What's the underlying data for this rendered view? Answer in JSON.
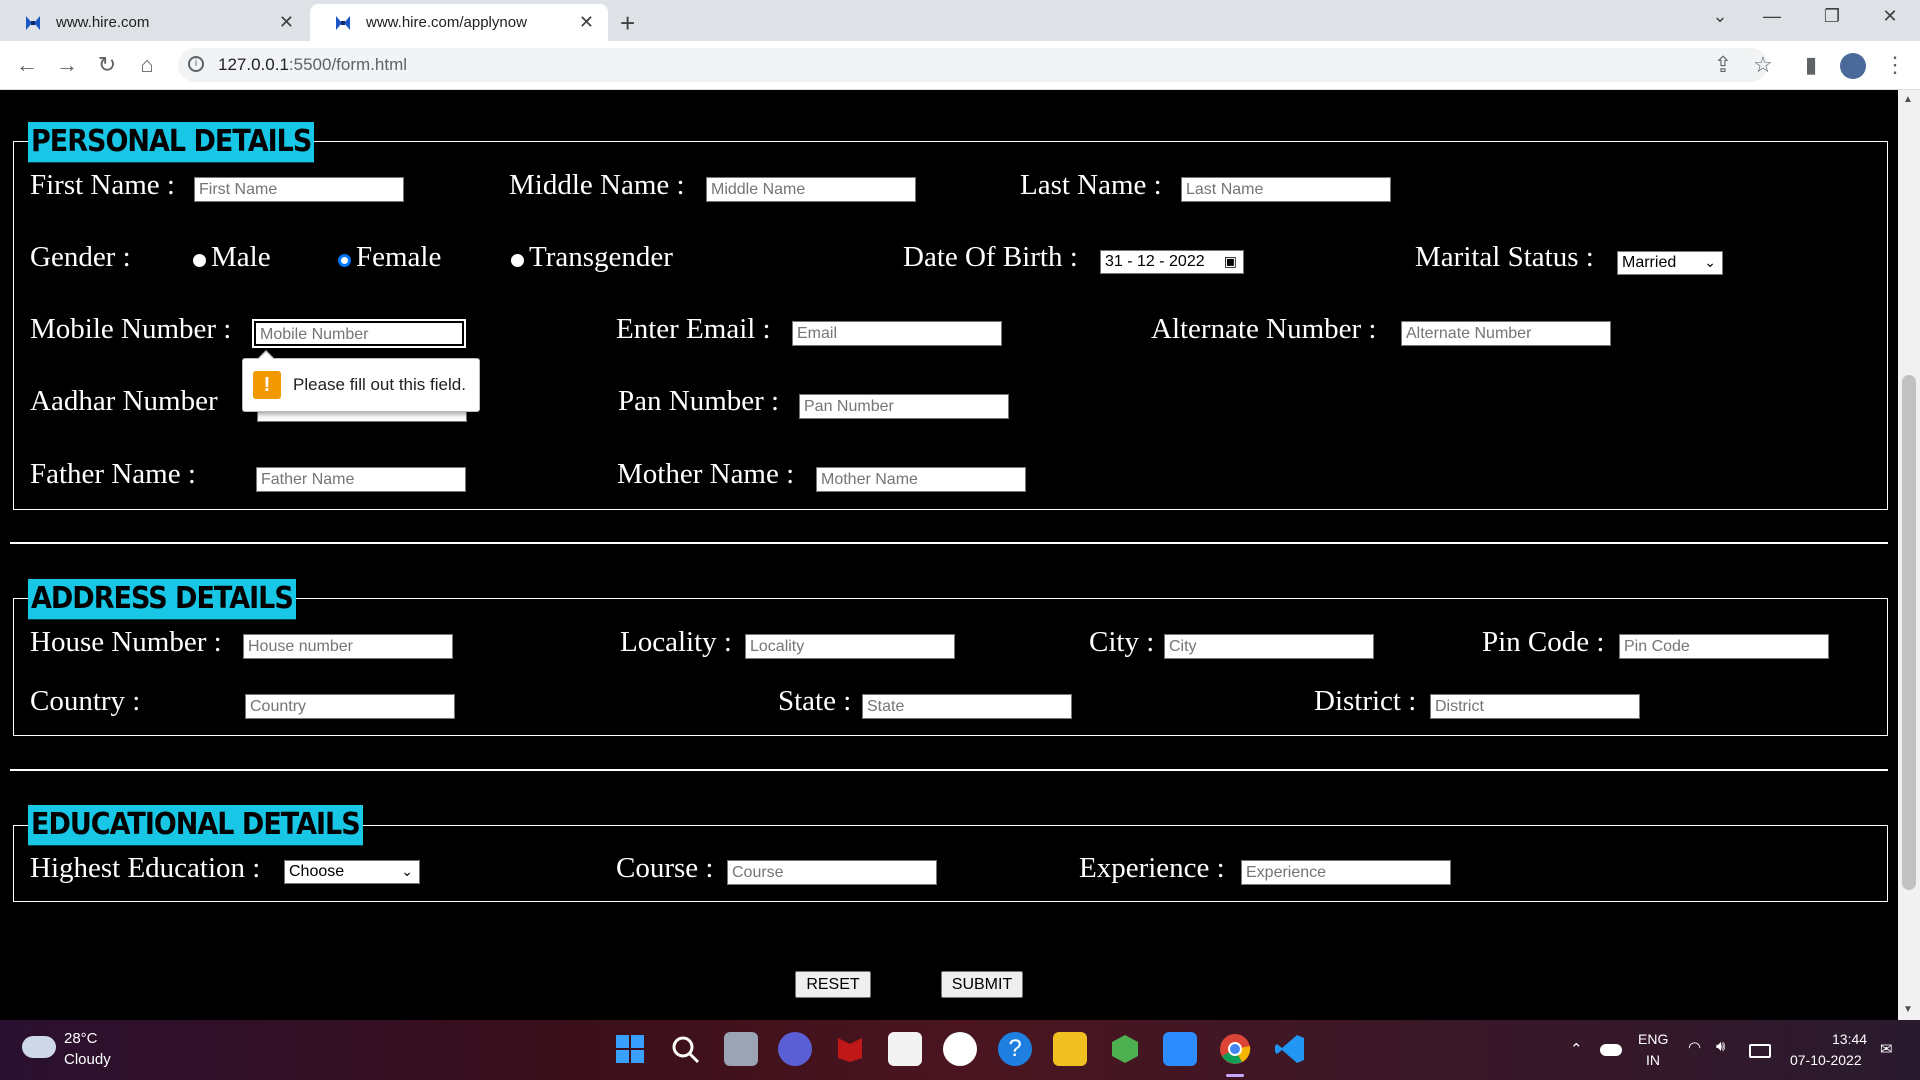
{
  "browser": {
    "tabs": [
      {
        "title": "www.hire.com"
      },
      {
        "title": "www.hire.com/applynow",
        "active": true
      }
    ],
    "url_host": "127.0.0.1",
    "url_rest": ":5500/form.html"
  },
  "personal": {
    "legend": "PERSONAL DETAILS",
    "first_name": {
      "label": "First Name :",
      "placeholder": "First Name"
    },
    "middle_name": {
      "label": "Middle Name :",
      "placeholder": "Middle Name"
    },
    "last_name": {
      "label": "Last Name :",
      "placeholder": "Last Name"
    },
    "gender": {
      "label": "Gender :",
      "options": [
        "Male",
        "Female",
        "Transgender"
      ],
      "selected": "Female"
    },
    "dob": {
      "label": "Date Of Birth :",
      "value": "31 - 12 - 2022"
    },
    "marital": {
      "label": "Marital Status :",
      "value": "Married"
    },
    "mobile": {
      "label": "Mobile Number :",
      "placeholder": "Mobile Number"
    },
    "email": {
      "label": "Enter Email :",
      "placeholder": "Email"
    },
    "alternate": {
      "label": "Alternate Number :",
      "placeholder": "Alternate Number"
    },
    "aadhar": {
      "label": "Aadhar Number"
    },
    "pan": {
      "label": "Pan Number :",
      "placeholder": "Pan Number"
    },
    "father": {
      "label": "Father Name :",
      "placeholder": "Father Name"
    },
    "mother": {
      "label": "Mother Name :",
      "placeholder": "Mother Name"
    },
    "tooltip": "Please fill out this field."
  },
  "address": {
    "legend": "ADDRESS DETAILS",
    "house": {
      "label": "House Number :",
      "placeholder": "House number"
    },
    "locality": {
      "label": "Locality :",
      "placeholder": "Locality"
    },
    "city": {
      "label": "City :",
      "placeholder": "City"
    },
    "pincode": {
      "label": "Pin Code :",
      "placeholder": "Pin Code"
    },
    "country": {
      "label": "Country :",
      "placeholder": "Country"
    },
    "state": {
      "label": "State :",
      "placeholder": "State"
    },
    "district": {
      "label": "District :",
      "placeholder": "District"
    }
  },
  "education": {
    "legend": "EDUCATIONAL DETAILS",
    "highest": {
      "label": "Highest Education :",
      "value": "Choose"
    },
    "course": {
      "label": "Course :",
      "placeholder": "Course"
    },
    "experience": {
      "label": "Experience :",
      "placeholder": "Experience"
    }
  },
  "buttons": {
    "reset": "RESET",
    "submit": "SUBMIT"
  },
  "taskbar": {
    "weather_temp": "28°C",
    "weather_desc": "Cloudy",
    "lang_top": "ENG",
    "lang_bottom": "IN",
    "time": "13:44",
    "date": "07-10-2022"
  },
  "colors": {
    "legend_bg": "#18c6e6",
    "page_bg": "#000000",
    "radio_accent": "#0075ff"
  }
}
